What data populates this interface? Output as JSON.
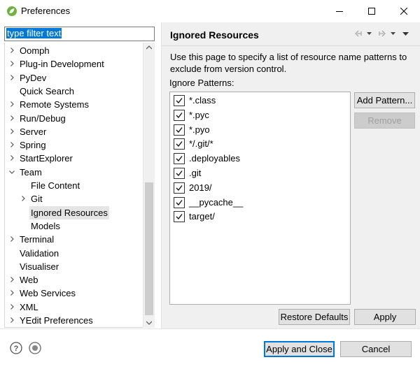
{
  "window": {
    "title": "Preferences"
  },
  "filter": {
    "text": "type filter text"
  },
  "tree": {
    "items": [
      {
        "label": "Oomph",
        "expander": "collapsed"
      },
      {
        "label": "Plug-in Development",
        "expander": "collapsed"
      },
      {
        "label": "PyDev",
        "expander": "collapsed"
      },
      {
        "label": "Quick Search",
        "expander": "none"
      },
      {
        "label": "Remote Systems",
        "expander": "collapsed"
      },
      {
        "label": "Run/Debug",
        "expander": "collapsed"
      },
      {
        "label": "Server",
        "expander": "collapsed"
      },
      {
        "label": "Spring",
        "expander": "collapsed"
      },
      {
        "label": "StartExplorer",
        "expander": "collapsed"
      },
      {
        "label": "Team",
        "expander": "expanded"
      },
      {
        "label": "File Content",
        "expander": "none",
        "child": true
      },
      {
        "label": "Git",
        "expander": "collapsed",
        "child": true
      },
      {
        "label": "Ignored Resources",
        "expander": "none",
        "child": true,
        "selected": true
      },
      {
        "label": "Models",
        "expander": "none",
        "child": true
      },
      {
        "label": "Terminal",
        "expander": "collapsed"
      },
      {
        "label": "Validation",
        "expander": "none"
      },
      {
        "label": "Visualiser",
        "expander": "none"
      },
      {
        "label": "Web",
        "expander": "collapsed"
      },
      {
        "label": "Web Services",
        "expander": "collapsed"
      },
      {
        "label": "XML",
        "expander": "collapsed"
      },
      {
        "label": "YEdit Preferences",
        "expander": "collapsed"
      }
    ]
  },
  "page": {
    "title": "Ignored Resources",
    "description": "Use this page to specify a list of resource name patterns to exclude from version control.",
    "patterns_label": "Ignore Patterns:",
    "patterns": [
      {
        "text": "*.class",
        "checked": true
      },
      {
        "text": "*.pyc",
        "checked": true
      },
      {
        "text": "*.pyo",
        "checked": true
      },
      {
        "text": "*/.git/*",
        "checked": true
      },
      {
        "text": ".deployables",
        "checked": true
      },
      {
        "text": ".git",
        "checked": true
      },
      {
        "text": "2019/",
        "checked": true
      },
      {
        "text": "__pycache__",
        "checked": true
      },
      {
        "text": "target/",
        "checked": true
      }
    ]
  },
  "buttons": {
    "add_pattern": "Add Pattern...",
    "remove": "Remove",
    "restore_defaults": "Restore Defaults",
    "apply": "Apply",
    "apply_and_close": "Apply and Close",
    "cancel": "Cancel"
  },
  "icons": {
    "app": "spring-leaf-icon",
    "back": "back-arrow-icon",
    "forward": "forward-arrow-icon",
    "menu": "view-menu-icon",
    "help": "help-icon",
    "record": "record-macro-icon"
  },
  "colors": {
    "selection": "#0078d7",
    "accent": "#6db33f"
  }
}
